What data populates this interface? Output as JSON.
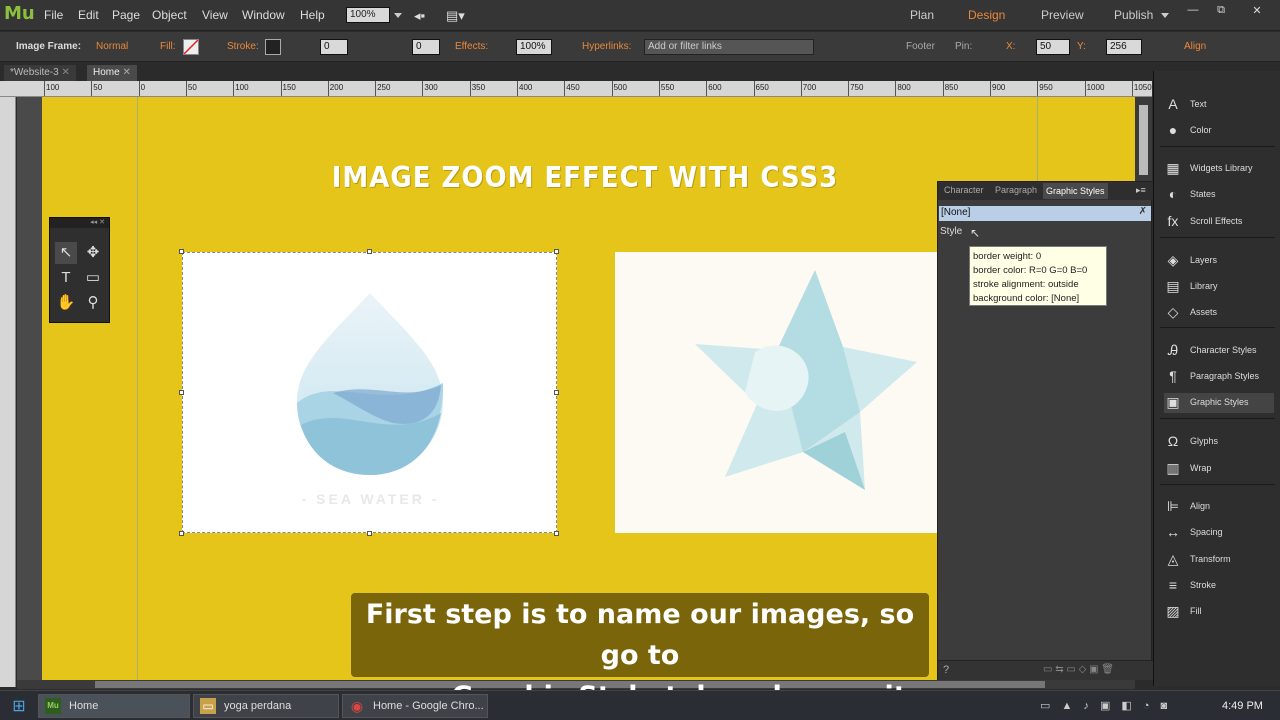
{
  "app": {
    "logo": "Mu",
    "menu": [
      "File",
      "Edit",
      "Page",
      "Object",
      "View",
      "Window",
      "Help"
    ],
    "zoom": "100%",
    "modes": [
      "Plan",
      "Design",
      "Preview",
      "Publish"
    ],
    "active_mode": "Design",
    "window_buttons": [
      "—",
      "⧉",
      "✕"
    ]
  },
  "control_bar": {
    "frame_label": "Image Frame:",
    "frame_state": "Normal",
    "fill_label": "Fill:",
    "stroke_label": "Stroke:",
    "stroke_value": "0",
    "corner_value": "0",
    "effects_label": "Effects:",
    "effects_value": "100%",
    "hyperlinks_label": "Hyperlinks:",
    "hyperlinks_placeholder": "Add or filter links",
    "footer_label": "Footer",
    "pin_label": "Pin:",
    "x_label": "X:",
    "x_value": "50",
    "y_label": "Y:",
    "y_value": "256",
    "align_label": "Align"
  },
  "tabs": [
    {
      "label": "*Website-3"
    },
    {
      "label": "Home"
    }
  ],
  "ruler_ticks": [
    "100",
    "50",
    "0",
    "50",
    "100",
    "150",
    "200",
    "250",
    "300",
    "350",
    "400",
    "450",
    "500",
    "550",
    "600",
    "650",
    "700",
    "750",
    "800",
    "850",
    "900",
    "950",
    "1000",
    "1050"
  ],
  "page": {
    "headline": "IMAGE ZOOM EFFECT WITH CSS3",
    "image1_caption": "- SEA WATER -"
  },
  "graphic_styles_panel": {
    "tabs": [
      "Character",
      "Paragraph",
      "Graphic Styles"
    ],
    "active_tab": "Graphic Styles",
    "selected_style": "[None]",
    "style_label": "Style",
    "tooltip_lines": [
      "border weight: 0",
      "border color: R=0 G=0 B=0",
      "stroke alignment: outside",
      "background color: [None]"
    ]
  },
  "right_panel": {
    "items": [
      {
        "label": "Text",
        "icon": "A"
      },
      {
        "label": "Color",
        "icon": "●"
      },
      {
        "label": "Widgets Library",
        "icon": "▦"
      },
      {
        "label": "States",
        "icon": "◐"
      },
      {
        "label": "Scroll Effects",
        "icon": "fx"
      },
      {
        "label": "Layers",
        "icon": "◈"
      },
      {
        "label": "Library",
        "icon": "▤"
      },
      {
        "label": "Assets",
        "icon": "◇"
      },
      {
        "label": "Character Styles",
        "icon": "Ꭿ"
      },
      {
        "label": "Paragraph Styles",
        "icon": "¶"
      },
      {
        "label": "Graphic Styles",
        "icon": "▣"
      },
      {
        "label": "Glyphs",
        "icon": "Ω"
      },
      {
        "label": "Wrap",
        "icon": "▥"
      },
      {
        "label": "Align",
        "icon": "⊫"
      },
      {
        "label": "Spacing",
        "icon": "↔"
      },
      {
        "label": "Transform",
        "icon": "◬"
      },
      {
        "label": "Stroke",
        "icon": "≡"
      },
      {
        "label": "Fill",
        "icon": "▨"
      }
    ],
    "selected": "Graphic Styles"
  },
  "caption": {
    "line1": "First step is to name our images, so go to",
    "line2": "your Graphic Style tab and name it"
  },
  "taskbar": {
    "buttons": [
      {
        "label": "Home",
        "icon": "Mu",
        "color": "#2e5e1e"
      },
      {
        "label": "yoga perdana",
        "icon": "▭",
        "color": "#c9a14a"
      },
      {
        "label": "Home - Google Chro...",
        "icon": "◉",
        "color": "#d44"
      }
    ],
    "clock": "4:49 PM"
  },
  "colors": {
    "page_bg": "#e5c51a",
    "accent": "#e8893a",
    "caption_bg": "#6e5a0a"
  }
}
